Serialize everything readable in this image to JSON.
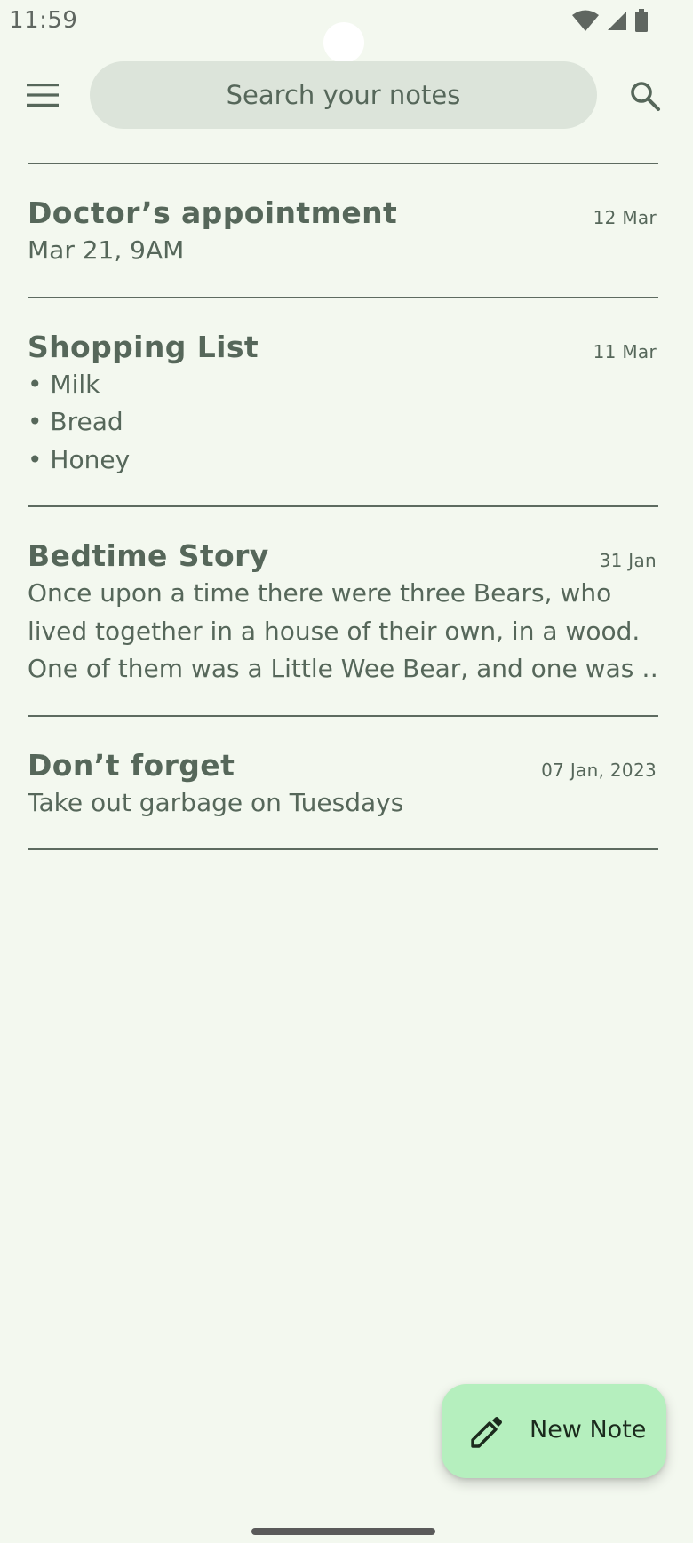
{
  "status_bar": {
    "time": "11:59",
    "icons": [
      "wifi-icon",
      "cell-signal-icon",
      "battery-icon"
    ]
  },
  "top_bar": {
    "menu_icon": "menu-icon",
    "search_placeholder": "Search your notes",
    "search_icon": "search-icon"
  },
  "notes": [
    {
      "title": "Doctor’s appointment",
      "date": "12 Mar",
      "body": [
        "Mar 21, 9AM"
      ]
    },
    {
      "title": "Shopping List",
      "date": "11 Mar",
      "body": [
        "• Milk",
        "• Bread",
        "• Honey"
      ]
    },
    {
      "title": "Bedtime Story",
      "date": "31 Jan",
      "body": [
        "Once upon a time there were three Bears, who",
        "lived together in a house of their own, in a wood.",
        "One of them was a Little Wee Bear, and one was …"
      ]
    },
    {
      "title": "Don’t forget",
      "date": "07 Jan, 2023",
      "body": [
        "Take out garbage on Tuesdays"
      ]
    }
  ],
  "fab": {
    "label": "New Note",
    "icon": "pencil-icon"
  },
  "colors": {
    "background": "#F3F8EF",
    "search_pill": "#DCE4DA",
    "text": "#56675A",
    "fab": "#B5EFBE",
    "divider": "#5D6B60"
  }
}
